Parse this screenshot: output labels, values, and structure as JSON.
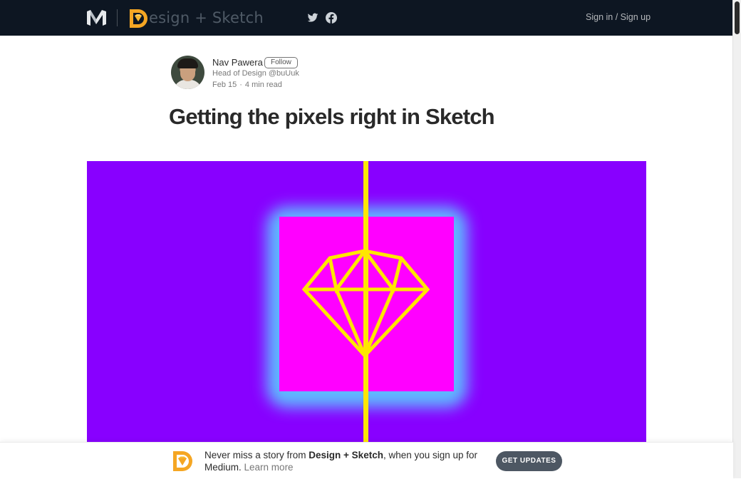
{
  "topbar": {
    "publication_name": "esign + Sketch",
    "signin_label": "Sign in / Sign up"
  },
  "icons": {
    "medium_logo": "medium-logo-icon",
    "twitter": "twitter-icon",
    "facebook": "facebook-icon"
  },
  "author": {
    "name": "Nav Pawera",
    "follow_label": "Follow",
    "bio": "Head of Design @buUuk",
    "date": "Feb 15",
    "separator": "·",
    "read_time": "4 min read"
  },
  "article": {
    "title": "Getting the pixels right in Sketch"
  },
  "hero": {
    "background_color": "#8800ff",
    "glow_color": "#5fb8ff",
    "square_color": "#ff00ff",
    "line_color": "#ffe600",
    "icon": "sketch-diamond-icon"
  },
  "banner": {
    "text_prefix": "Never miss a story from ",
    "publication": "Design + Sketch",
    "text_suffix": ", when you sign up for Medium. ",
    "learn_more": "Learn more",
    "cta_label": "GET UPDATES"
  },
  "colors": {
    "topbar_bg": "#0d1622",
    "cta_bg": "#4d5763",
    "logo_orange": "#f5a623"
  }
}
